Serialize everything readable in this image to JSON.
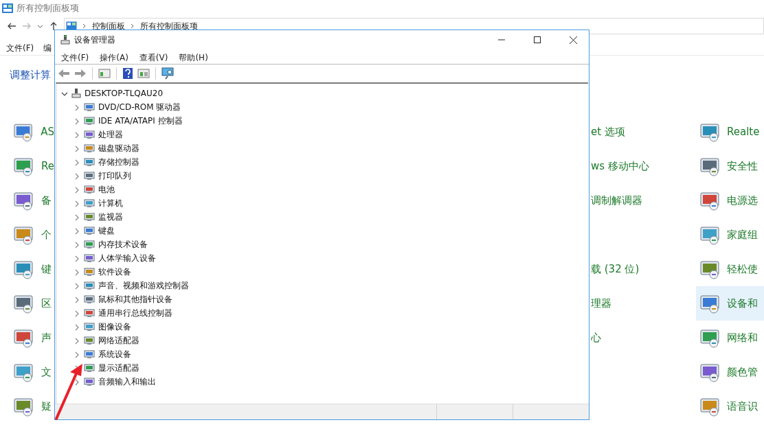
{
  "background_window": {
    "title": "所有控制面板项",
    "breadcrumb": [
      "控制面板",
      "所有控制面板项"
    ],
    "menu": [
      "文件(F)",
      "编"
    ],
    "heading": "调整计算",
    "rows": [
      {
        "left": "AS",
        "middle": "et 选项",
        "right": "Realte",
        "selected": false
      },
      {
        "left": "Re",
        "middle": "ws 移动中心",
        "right": "安全性",
        "selected": false
      },
      {
        "left": "备",
        "middle": "调制解调器",
        "right": "电源选",
        "selected": false
      },
      {
        "left": "个",
        "right": "家庭组",
        "selected": false
      },
      {
        "left": "键",
        "middle": "载 (32 位)",
        "right": "轻松使",
        "selected": false
      },
      {
        "left": "区",
        "middle": "理器",
        "right": "设备和",
        "selected": true
      },
      {
        "left": "声",
        "middle": "心",
        "right": "网络和",
        "selected": false
      },
      {
        "left": "文",
        "right": "颜色管",
        "selected": false
      },
      {
        "left": "疑",
        "right": "语音识",
        "selected": false
      }
    ]
  },
  "device_manager": {
    "title": "设备管理器",
    "menu": [
      "文件(F)",
      "操作(A)",
      "查看(V)",
      "帮助(H)"
    ],
    "tree": {
      "label": "DESKTOP-TLQAU20",
      "expanded": true,
      "children": [
        {
          "label": "DVD/CD-ROM 驱动器",
          "expanded": false
        },
        {
          "label": "IDE ATA/ATAPI 控制器",
          "expanded": false
        },
        {
          "label": "处理器",
          "expanded": false
        },
        {
          "label": "磁盘驱动器",
          "expanded": false
        },
        {
          "label": "存储控制器",
          "expanded": false
        },
        {
          "label": "打印队列",
          "expanded": false
        },
        {
          "label": "电池",
          "expanded": false
        },
        {
          "label": "计算机",
          "expanded": false
        },
        {
          "label": "监视器",
          "expanded": false
        },
        {
          "label": "键盘",
          "expanded": false
        },
        {
          "label": "内存技术设备",
          "expanded": false
        },
        {
          "label": "人体学输入设备",
          "expanded": false
        },
        {
          "label": "软件设备",
          "expanded": false
        },
        {
          "label": "声音、视频和游戏控制器",
          "expanded": false
        },
        {
          "label": "鼠标和其他指针设备",
          "expanded": false
        },
        {
          "label": "通用串行总线控制器",
          "expanded": false
        },
        {
          "label": "图像设备",
          "expanded": false
        },
        {
          "label": "网络适配器",
          "expanded": false
        },
        {
          "label": "系统设备",
          "expanded": false
        },
        {
          "label": "显示适配器",
          "expanded": false
        },
        {
          "label": "音频输入和输出",
          "expanded": false
        }
      ]
    }
  }
}
